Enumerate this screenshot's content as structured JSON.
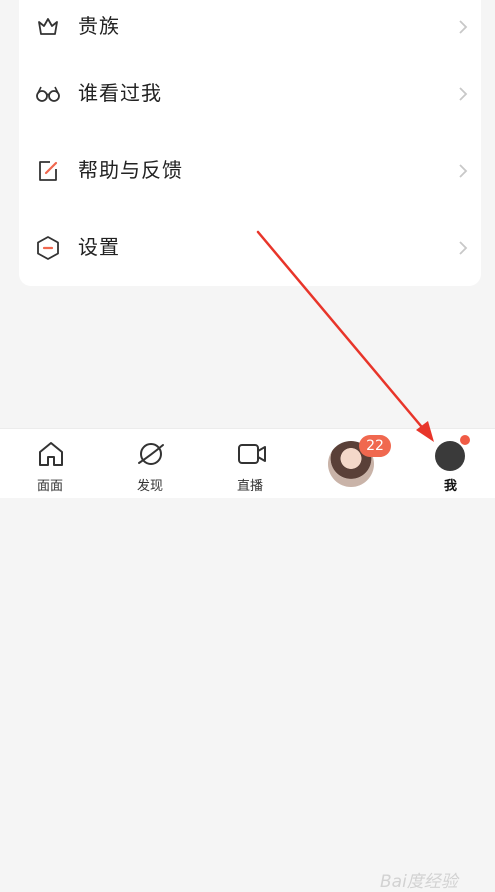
{
  "menu": {
    "items": [
      {
        "label": "贵族",
        "icon": "crown-icon"
      },
      {
        "label": "谁看过我",
        "icon": "glasses-icon"
      },
      {
        "label": "帮助与反馈",
        "icon": "edit-feedback-icon"
      },
      {
        "label": "设置",
        "icon": "settings-hexagon-icon"
      }
    ]
  },
  "tabbar": {
    "tabs": [
      {
        "label": "面面",
        "icon": "home-icon"
      },
      {
        "label": "发现",
        "icon": "planet-icon"
      },
      {
        "label": "直播",
        "icon": "video-camera-icon"
      },
      {
        "label": "",
        "icon": "avatar-icon"
      },
      {
        "label": "我",
        "icon": "me-avatar-icon"
      }
    ],
    "messages_badge": "22"
  },
  "watermark": "Bai度经验",
  "colors": {
    "accent": "#f0684f",
    "arrow": "#e8352a"
  }
}
